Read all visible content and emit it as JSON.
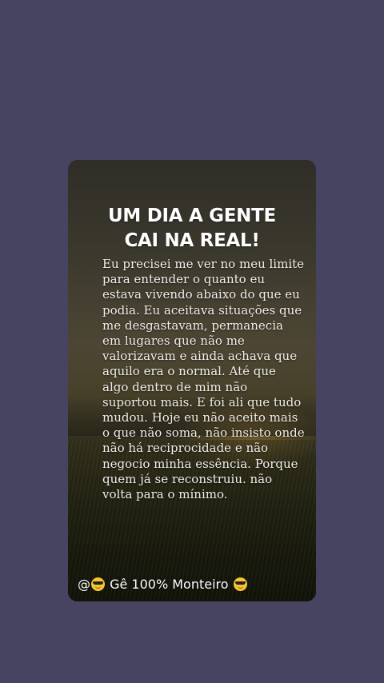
{
  "post": {
    "title_lines": [
      "UM DIA A GENTE",
      "CAI NA REAL!"
    ],
    "body_lines": [
      "Eu precisei me ver no meu limite",
      "para entender o quanto eu",
      "estava vivendo abaixo do que eu",
      "podia. Eu aceitava situações que",
      "me desgastavam, permanecia",
      "em lugares que não me",
      "valorizavam e ainda achava que",
      "aquilo era o normal. Até que",
      "algo dentro de mim não",
      "suportou mais. E foi ali que tudo",
      "mudou. Hoje eu não aceito mais",
      "o que não soma, não insisto onde",
      "não há reciprocidade e não",
      "negocio minha essência. Porque",
      "quem já se reconstruiu. não",
      "volta para o mínimo."
    ],
    "author": {
      "prefix": "@",
      "name": "Gê 100% Monteiro",
      "emoji_icon": "sunglasses-face-emoji"
    }
  },
  "colors": {
    "background": "#474462",
    "text": "#ffffff"
  }
}
